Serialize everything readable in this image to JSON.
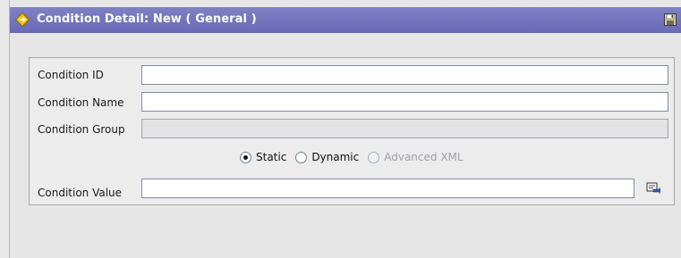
{
  "window": {
    "title": "Condition Detail: New ( General )"
  },
  "form": {
    "condition_id": {
      "label": "Condition ID",
      "value": ""
    },
    "condition_name": {
      "label": "Condition Name",
      "value": ""
    },
    "condition_group": {
      "label": "Condition Group",
      "value": ""
    },
    "condition_type": {
      "options": [
        {
          "label": "Static",
          "selected": true,
          "enabled": true
        },
        {
          "label": "Dynamic",
          "selected": false,
          "enabled": true
        },
        {
          "label": "Advanced XML",
          "selected": false,
          "enabled": false
        }
      ]
    },
    "condition_value": {
      "label": "Condition Value",
      "value": ""
    }
  },
  "icons": {
    "title": "diamond-arrow-icon",
    "save": "save-floppy-icon",
    "lookup": "lookup-icon"
  },
  "colors": {
    "titlebar": "#7272bd",
    "title_text": "#ffffff",
    "panel_bg": "#ececec",
    "disabled_text": "#a0a0a6"
  }
}
